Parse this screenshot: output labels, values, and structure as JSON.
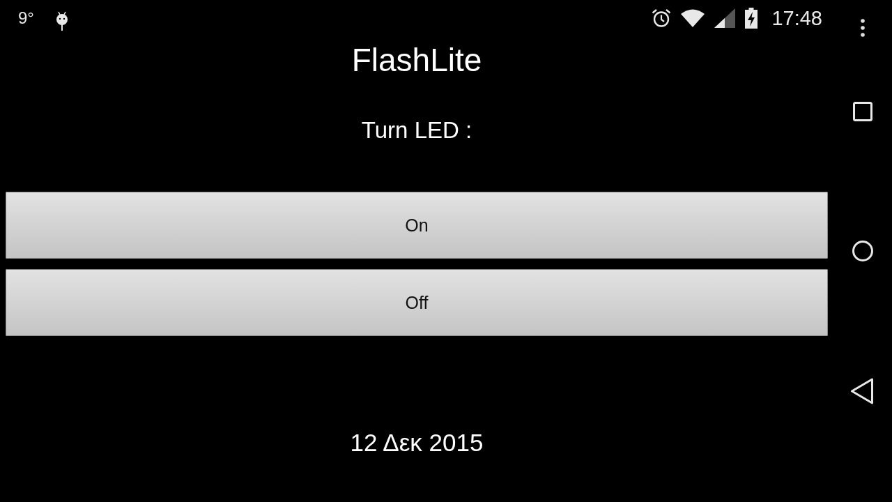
{
  "status_bar": {
    "temperature": "9°",
    "time": "17:48"
  },
  "app": {
    "title": "FlashLite",
    "prompt": "Turn LED :",
    "buttons": [
      "On",
      "Off"
    ],
    "date": "12 Δεκ 2015"
  }
}
